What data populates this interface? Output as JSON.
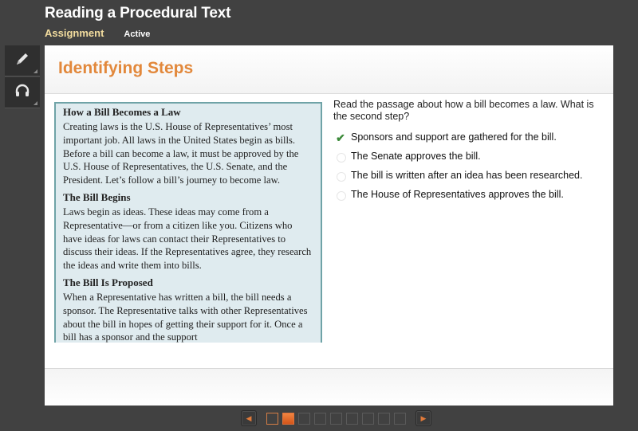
{
  "header": {
    "title": "Reading a Procedural Text",
    "assignment_label": "Assignment",
    "status": "Active"
  },
  "toolbar": {
    "tools": [
      {
        "icon": "pencil-icon",
        "label": "Annotate"
      },
      {
        "icon": "headphones-icon",
        "label": "Audio"
      }
    ]
  },
  "panel": {
    "title": "Identifying Steps"
  },
  "passage": {
    "sections": [
      {
        "heading": "How a Bill Becomes a Law",
        "body": "Creating laws is the U.S. House of Representatives’ most important job. All laws in the United States begin as bills. Before a bill can become a law, it must be approved by the U.S. House of Representatives, the U.S. Senate, and the President. Let’s follow a bill’s journey to become law."
      },
      {
        "heading": "The Bill Begins",
        "body": "Laws begin as ideas. These ideas may come from a Representative—or from a citizen like you. Citizens who have ideas for laws can contact their Representatives to discuss their ideas. If the Representatives agree, they research the ideas and write them into bills."
      },
      {
        "heading": "The Bill Is Proposed",
        "body": "When a Representative has written a bill, the bill needs a sponsor. The Representative talks with other Representatives about the bill in hopes of getting their support for it. Once a bill has a sponsor and the support"
      }
    ]
  },
  "question": {
    "prompt": "Read the passage about how a bill becomes a law. What is the second step?",
    "options": [
      {
        "text": "Sponsors and support are gathered for the bill.",
        "selected": true
      },
      {
        "text": "The Senate approves the bill.",
        "selected": false
      },
      {
        "text": "The bill is written after an idea has been researched.",
        "selected": false
      },
      {
        "text": "The House of Representatives approves the bill.",
        "selected": false
      }
    ]
  },
  "pager": {
    "total_pages": 9,
    "current_page": 2,
    "visited_pages": [
      1
    ],
    "prev_icon": "triangle-left-icon",
    "next_icon": "triangle-right-icon",
    "accent_color": "#e2733a"
  }
}
